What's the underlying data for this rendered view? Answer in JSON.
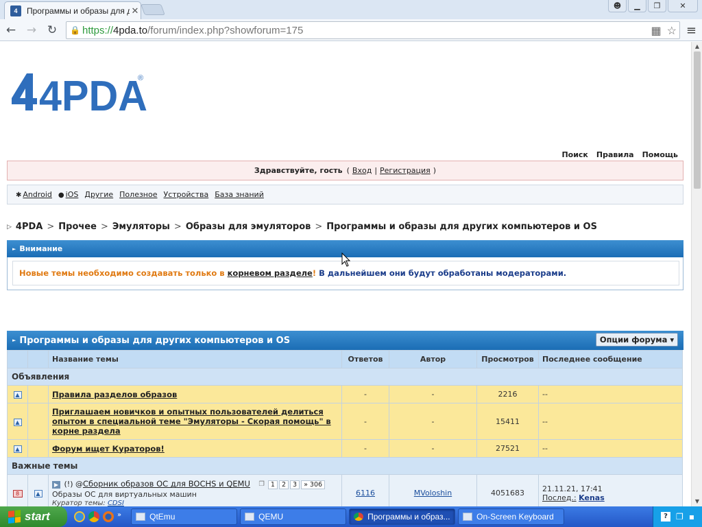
{
  "browser": {
    "tab_title": "Программы и образы для д",
    "tab_favicon": "4",
    "url_scheme": "https://",
    "url_host": "4pda.to",
    "url_path": "/forum/index.php?showforum=175"
  },
  "site": {
    "logo_text": "4PDA",
    "logo_mark": "®",
    "brand_color": "#2f6ebc",
    "top_links": [
      "Поиск",
      "Правила",
      "Помощь"
    ],
    "welcome_text": "Здравствуйте, гость",
    "login_label": "Вход",
    "register_label": "Регистрация",
    "platforms": [
      "Android",
      "iOS",
      "Другие",
      "Полезное",
      "Устройства",
      "База знаний"
    ]
  },
  "breadcrumb": [
    "4PDA",
    "Прочее",
    "Эмуляторы",
    "Образы для эмуляторов",
    "Программы и образы для других компьютеров и OS"
  ],
  "attention": {
    "title": "Внимание",
    "text_orange": "Новые темы необходимо создавать только в",
    "link": "корневом разделе",
    "exclaim": "!",
    "text_blue": "В дальнейшем они будут обработаны модераторами."
  },
  "forum": {
    "title": "Программы и образы для других компьютеров и OS",
    "options_label": "Опции форума ▾",
    "columns": {
      "topic": "Название темы",
      "replies": "Ответов",
      "author": "Автор",
      "views": "Просмотров",
      "last": "Последнее сообщение"
    },
    "section_announcements": "Объявления",
    "announcements": [
      {
        "title": "Правила разделов образов",
        "replies": "-",
        "author": "-",
        "views": "2216",
        "last": "--"
      },
      {
        "title": "Приглашаем новичков и опытных пользователей делиться опытом в специальной теме \"Эмуляторы - Скорая помощь\" в корне раздела",
        "replies": "-",
        "author": "-",
        "views": "15411",
        "last": "--"
      },
      {
        "title": "Форум ищет Кураторов!",
        "replies": "-",
        "author": "-",
        "views": "27521",
        "last": "--"
      }
    ],
    "section_important": "Важные темы",
    "important": [
      {
        "prefix": "(!)",
        "title": "Сборник образов ОС для BOCHS и QEMU",
        "pages": [
          "1",
          "2",
          "3",
          "» 306"
        ],
        "subtitle": "Образы ОС для виртуальных машин",
        "curator_label": "Куратор темы:",
        "curator": "CDSI",
        "replies": "6116",
        "author": "MVoloshin",
        "views": "4051683",
        "last_date": "21.11.21, 17:41",
        "last_label": "Послед.:",
        "last_author": "Kenas"
      }
    ]
  },
  "taskbar": {
    "start_label": "start",
    "tasks": [
      "QtEmu",
      "QEMU",
      "Программы и образ...",
      "On-Screen Keyboard"
    ],
    "tray_help": "?"
  }
}
